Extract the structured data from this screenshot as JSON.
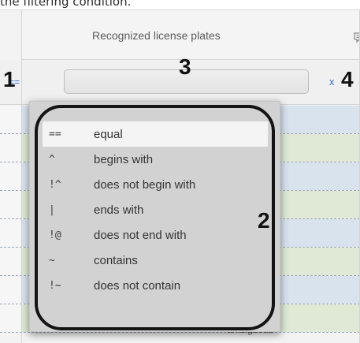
{
  "caption": "the filtering condition.",
  "column": {
    "title": "Recognized license plates",
    "comment_icon": "comment-icon"
  },
  "filter": {
    "operator": "==",
    "value": "",
    "placeholder": "",
    "clear": "x"
  },
  "callouts": [
    "1",
    "2",
    "3",
    "4"
  ],
  "operators": [
    {
      "symbol": "==",
      "label": "equal",
      "selected": true
    },
    {
      "symbol": "^",
      "label": "begins with"
    },
    {
      "symbol": "!^",
      "label": "does not begin with"
    },
    {
      "symbol": "|",
      "label": "ends with"
    },
    {
      "symbol": "!@",
      "label": "does not end with"
    },
    {
      "symbol": "~",
      "label": "contains"
    },
    {
      "symbol": "!~",
      "label": "does not contain"
    }
  ],
  "rows": [
    {
      "color": "blue",
      "text": ""
    },
    {
      "color": "green",
      "text": ""
    },
    {
      "color": "blue",
      "text": ""
    },
    {
      "color": "green",
      "text": ""
    },
    {
      "color": "blue",
      "text": ""
    },
    {
      "color": "green",
      "text": ""
    },
    {
      "color": "blue",
      "text": ""
    },
    {
      "color": "green",
      "text": "ambiguous"
    }
  ],
  "colors": {
    "link": "#2a6fd6",
    "row_blue": "#d9e3ee",
    "row_green": "#dfe9d6"
  }
}
